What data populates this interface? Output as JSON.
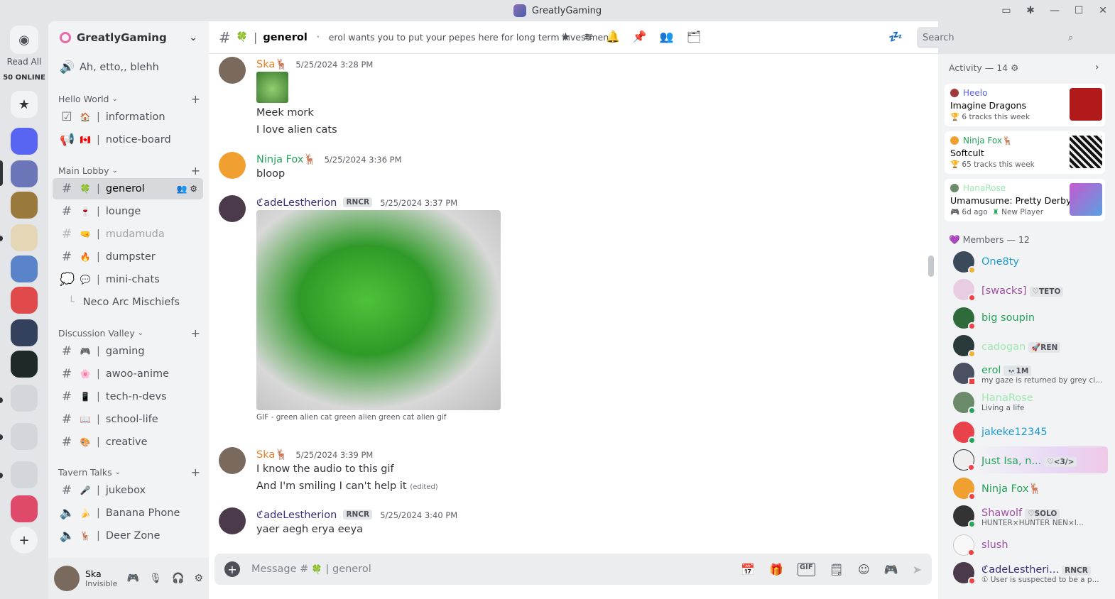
{
  "window": {
    "title": "GreatlyGaming"
  },
  "rail": {
    "read_all": "Read All",
    "online": "50 ONLINE"
  },
  "guild": {
    "name": "GreatlyGaming"
  },
  "sidebar": {
    "top_channel": {
      "name": "Ah, etto,, blehh"
    },
    "categories": [
      {
        "name": "Hello World"
      },
      {
        "name": "Main Lobby"
      },
      {
        "name": "Discussion Valley"
      },
      {
        "name": "Tavern Talks"
      }
    ],
    "hello_world": [
      {
        "emoji": "🏠",
        "name": "information"
      },
      {
        "emoji": "🇨🇦",
        "name": "notice-board"
      }
    ],
    "main_lobby": [
      {
        "emoji": "🍀",
        "name": "generol"
      },
      {
        "emoji": "🍷",
        "name": "lounge"
      },
      {
        "emoji": "🤜",
        "name": "mudamuda"
      },
      {
        "emoji": "🔥",
        "name": "dumpster"
      },
      {
        "emoji": "💬",
        "name": "mini-chats"
      },
      {
        "name": "Neco Arc Mischiefs"
      }
    ],
    "discussion_valley": [
      {
        "emoji": "🎮",
        "name": "gaming"
      },
      {
        "emoji": "🌸",
        "name": "awoo-anime"
      },
      {
        "emoji": "📱",
        "name": "tech-n-devs"
      },
      {
        "emoji": "📖",
        "name": "school-life"
      },
      {
        "emoji": "🎨",
        "name": "creative"
      }
    ],
    "tavern_talks": [
      {
        "emoji": "🎤",
        "name": "jukebox"
      },
      {
        "emoji": "🍌",
        "name": "Banana Phone"
      },
      {
        "emoji": "🦌",
        "name": "Deer Zone"
      }
    ]
  },
  "user": {
    "name": "Ska",
    "status": "Invisible"
  },
  "chat": {
    "channel": "generol",
    "topic": "erol wants you to put your pepes here for long term investments",
    "search_placeholder": "Search",
    "messages": [
      {
        "author": "Ska🦌",
        "time": "5/25/2024 3:28 PM",
        "lines": [
          "Meek mork",
          "I love alien cats"
        ]
      },
      {
        "author": "Ninja Fox🦌",
        "time": "5/25/2024 3:36 PM",
        "lines": [
          "bloop"
        ]
      },
      {
        "author": "ℭadeLestherion",
        "tag": "RNCR",
        "time": "5/25/2024 3:37 PM",
        "gif_caption": "GIF - green alien cat green alien green cat alien gif"
      },
      {
        "author": "Ska🦌",
        "time": "5/25/2024 3:39 PM",
        "lines": [
          "I know the audio to this gif",
          "And I'm smiling I can't help it"
        ],
        "edited": "(edited)"
      },
      {
        "author": "ℭadeLestherion",
        "tag": "RNCR",
        "time": "5/25/2024 3:40 PM",
        "lines": [
          "yaer aegh erya eeya"
        ]
      }
    ],
    "composer_placeholder": "Message #",
    "composer_channel": "generol"
  },
  "activity": {
    "header": "Activity — 14",
    "cards": [
      {
        "who": "Heelo",
        "what": "Imagine Dragons",
        "meta": "6 tracks this week",
        "color": "#5865f2"
      },
      {
        "who": "Ninja Fox🦌",
        "what": "Softcult",
        "meta": "65 tracks this week",
        "color": "#23a55a"
      },
      {
        "who": "HanaRose",
        "what": "Umamusume: Pretty Derby",
        "meta": "6d ago",
        "meta2": "New Player",
        "color": "#9ee8b0"
      }
    ]
  },
  "members": {
    "header": "Members — 12",
    "list": [
      {
        "name": "One8ty",
        "color": "#1f9bd3"
      },
      {
        "name": "[swacks]",
        "tag": "TETO",
        "color": "#a14fa4"
      },
      {
        "name": "big soupin",
        "color": "#23a55a"
      },
      {
        "name": "cadogan",
        "tag": "REN",
        "color": "#9ee8b0"
      },
      {
        "name": "erol",
        "tag": "1M",
        "sub": "my gaze is returned by grey cl...",
        "color": "#23a55a"
      },
      {
        "name": "HanaRose",
        "sub": "Living a life",
        "color": "#9ee8b0"
      },
      {
        "name": "jakeke12345",
        "color": "#1f9bd3"
      },
      {
        "name": "Just Isa, n...",
        "tag": "<3/>",
        "color": "#23a55a"
      },
      {
        "name": "Ninja Fox🦌",
        "color": "#23a55a"
      },
      {
        "name": "Shawolf",
        "tag": "SOLO",
        "sub": "HUNTER×HUNTER NEN×l...",
        "color": "#a14fa4"
      },
      {
        "name": "slush",
        "color": "#a14fa4"
      },
      {
        "name": "ℭadeLestheri...",
        "tag": "RNCR",
        "sub": "① User is suspected to be a p...",
        "color": "#3b2f7a"
      }
    ]
  }
}
